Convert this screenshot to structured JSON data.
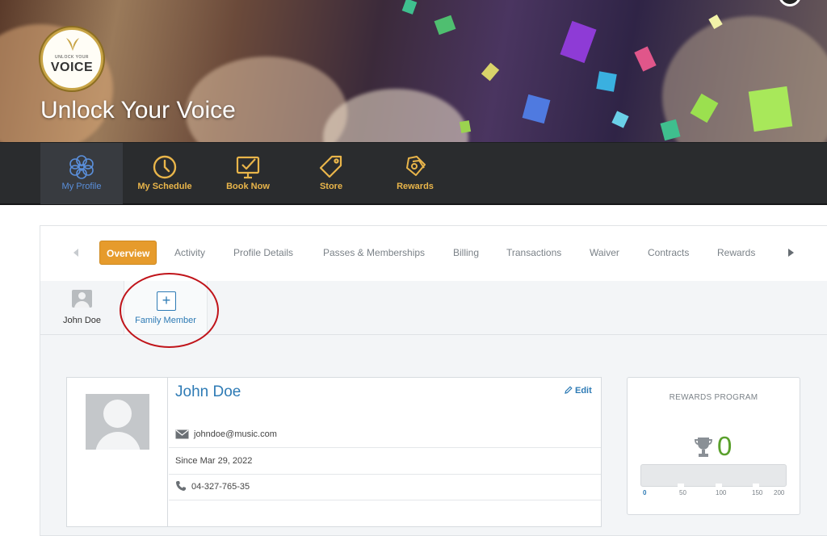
{
  "brand": {
    "logo_small": "UNLOCK YOUR",
    "logo_big": "VOICE",
    "hero_title": "Unlock Your Voice"
  },
  "nav": {
    "items": [
      {
        "label": "My Profile",
        "icon": "profile-flower-icon",
        "active": true
      },
      {
        "label": "My Schedule",
        "icon": "clock-icon",
        "active": false
      },
      {
        "label": "Book Now",
        "icon": "monitor-check-icon",
        "active": false
      },
      {
        "label": "Store",
        "icon": "price-tag-icon",
        "active": false
      },
      {
        "label": "Rewards",
        "icon": "reward-tags-icon",
        "active": false
      }
    ]
  },
  "tabs": [
    {
      "label": "Overview",
      "active": true
    },
    {
      "label": "Activity"
    },
    {
      "label": "Profile Details"
    },
    {
      "label": "Passes & Memberships"
    },
    {
      "label": "Billing"
    },
    {
      "label": "Transactions"
    },
    {
      "label": "Waiver"
    },
    {
      "label": "Contracts"
    },
    {
      "label": "Rewards"
    }
  ],
  "members": {
    "current": "John Doe",
    "add": "Family Member"
  },
  "profile": {
    "name": "John Doe",
    "edit_label": "Edit",
    "email": "johndoe@music.com",
    "since": "Since Mar 29, 2022",
    "phone": "04-327-765-35"
  },
  "rewards": {
    "title": "REWARDS PROGRAM",
    "points": "0",
    "progress": 0,
    "ticks": [
      "0",
      "50",
      "100",
      "150",
      "200"
    ]
  },
  "colors": {
    "accent_orange": "#e69b2c",
    "nav_gold": "#e9b54a",
    "link_blue": "#2e7bb5",
    "points_green": "#5aa02c",
    "annotation_red": "#c0141a"
  }
}
